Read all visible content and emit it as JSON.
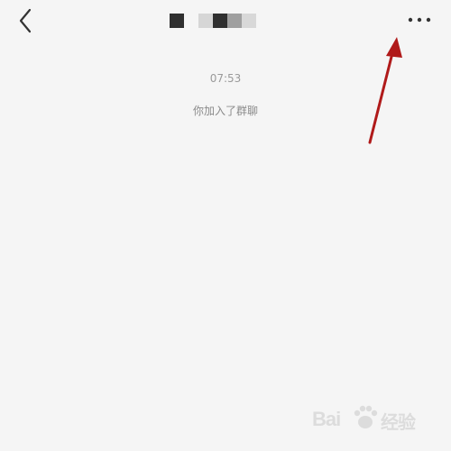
{
  "chat": {
    "timestamp": "07:53",
    "system_message": "你加入了群聊"
  },
  "header": {
    "back_icon": "chevron-left-icon",
    "more_icon": "more-dots-icon"
  },
  "colors": {
    "background": "#f5f5f5",
    "annotation_arrow": "#b01a1a"
  },
  "watermark": {
    "text_left": "Bai",
    "text_right": "经验"
  }
}
